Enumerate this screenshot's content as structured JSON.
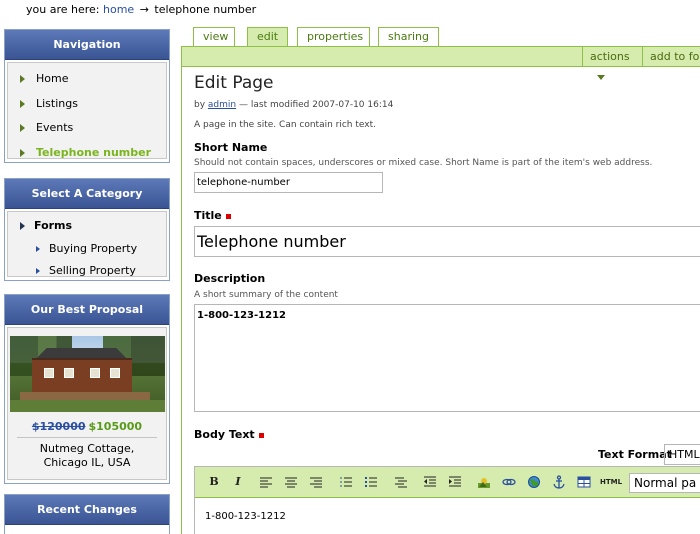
{
  "breadcrumb": {
    "prefix": "you are here:",
    "home": "home",
    "arrow": "→",
    "current": "telephone number"
  },
  "navigation": {
    "title": "Navigation",
    "items": [
      {
        "label": "Home"
      },
      {
        "label": "Listings"
      },
      {
        "label": "Events"
      },
      {
        "label": "Telephone number",
        "active": true
      }
    ]
  },
  "category": {
    "title": "Select A Category",
    "top": "Forms",
    "subs": [
      {
        "label": "Buying Property"
      },
      {
        "label": "Selling Property"
      }
    ]
  },
  "proposal": {
    "title": "Our Best Proposal",
    "old_price": "$120000",
    "new_price": "$105000",
    "caption": "Nutmeg Cottage, Chicago IL, USA"
  },
  "recent": {
    "title": "Recent Changes"
  },
  "tabs": [
    {
      "label": "view"
    },
    {
      "label": "edit",
      "active": true
    },
    {
      "label": "properties"
    },
    {
      "label": "sharing"
    }
  ],
  "actions": {
    "actions_label": "actions",
    "add_label": "add to fold"
  },
  "page": {
    "title": "Edit Page",
    "by": "by",
    "author": "admin",
    "modified": "— last modified 2007-07-10 16:14",
    "description": "A page in the site. Can contain rich text."
  },
  "fields": {
    "short_name": {
      "label": "Short Name",
      "help": "Should not contain spaces, underscores or mixed case. Short Name is part of the item's web address.",
      "value": "telephone-number"
    },
    "title": {
      "label": "Title",
      "value": "Telephone number"
    },
    "description": {
      "label": "Description",
      "help": "A short summary of the content",
      "value": "1-800-123-1212"
    },
    "body": {
      "label": "Body Text",
      "text_format_label": "Text Format",
      "text_format_value": "HTML",
      "paragraph_value": "Normal pa",
      "value": "1-800-123-1212"
    }
  },
  "toolbar": {
    "bold": "B",
    "italic": "I",
    "html": "HTML"
  },
  "colors": {
    "nav_header": "#3a5494",
    "accent_green": "#8ec046",
    "active_link": "#7ab51e",
    "required": "#dd0000"
  }
}
